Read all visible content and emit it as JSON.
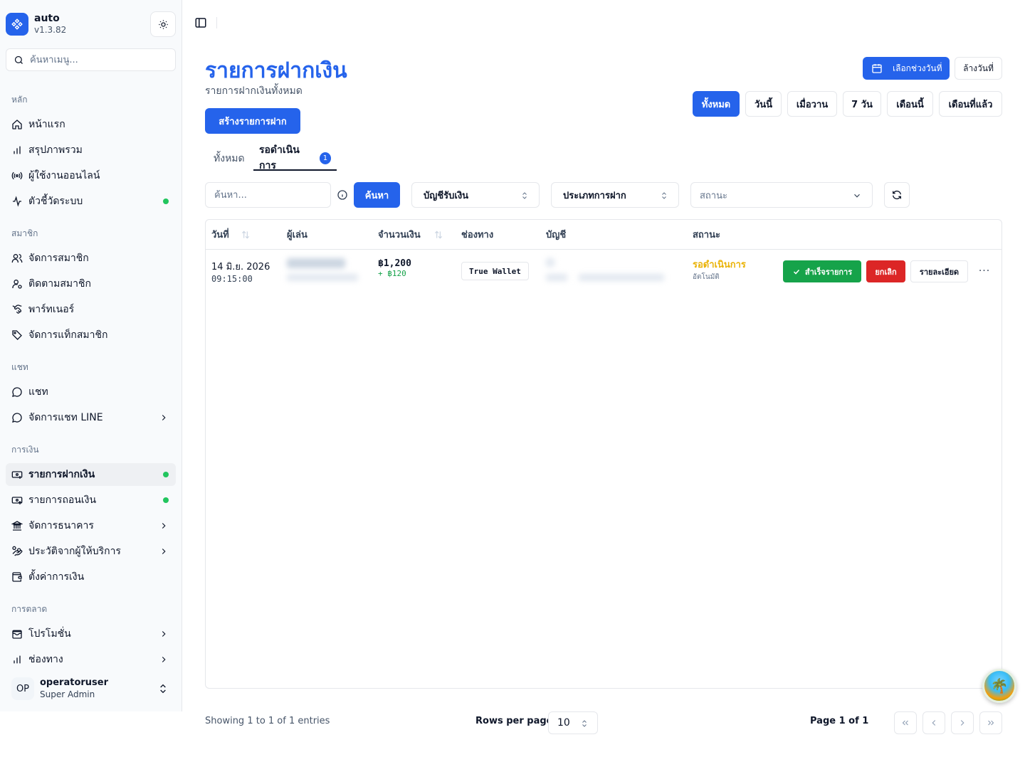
{
  "sidebar": {
    "brand": {
      "name": "auto",
      "version": "v1.3.82"
    },
    "search_placeholder": "ค้นหาเมนู...",
    "groups": {
      "main": "หลัก",
      "members": "สมาชิก",
      "chat": "แชท",
      "finance": "การเงิน",
      "marketing": "การตลาด"
    },
    "items": {
      "home": "หน้าแรก",
      "overview": "สรุปภาพรวม",
      "online_users": "ผู้ใช้งานออนไลน์",
      "metrics": "ตัวชี้วัดระบบ",
      "manage_members": "จัดการสมาชิก",
      "follow_members": "ติดตามสมาชิก",
      "partners": "พาร์ทเนอร์",
      "member_tags": "จัดการแท็กสมาชิก",
      "chat": "แชท",
      "line_chat": "จัดการแชท LINE",
      "deposits": "รายการฝากเงิน",
      "withdrawals": "รายการถอนเงิน",
      "banks": "จัดการธนาคาร",
      "provider_history": "ประวัติจากผู้ให้บริการ",
      "finance_settings": "ตั้งค่าการเงิน",
      "promotions": "โปรโมชั่น",
      "channels": "ช่องทาง"
    },
    "user": {
      "initials": "OP",
      "name": "operatoruser",
      "role": "Super Admin"
    }
  },
  "header": {
    "title": "รายการฝากเงิน",
    "subtitle": "รายการฝากเงินทั้งหมด",
    "create_button": "สร้างรายการฝาก",
    "date_picker_button": "เลือกช่วงวันที่",
    "clear_date_button": "ล้างวันที่",
    "ranges": [
      "ทั้งหมด",
      "วันนี้",
      "เมื่อวาน",
      "7 วัน",
      "เดือนนี้",
      "เดือนที่แล้ว"
    ],
    "active_range": "ทั้งหมด"
  },
  "tabs": {
    "all": "ทั้งหมด",
    "pending": "รอดำเนินการ",
    "pending_count": "1"
  },
  "filters": {
    "search_placeholder": "ค้นหา...",
    "search_button": "ค้นหา",
    "account_select": "บัญชีรับเงิน",
    "type_select": "ประเภทการฝาก",
    "status_placeholder": "สถานะ"
  },
  "table": {
    "headers": {
      "date": "วันที่",
      "player": "ผู้เล่น",
      "amount": "จำนวนเงิน",
      "channel": "ช่องทาง",
      "account": "บัญชี",
      "status": "สถานะ"
    },
    "rows": [
      {
        "date": "14 มิ.ย. 2026",
        "time": "09:15:00",
        "amount": "฿1,200",
        "bonus": "+ ฿120",
        "channel": "True Wallet",
        "status": "รอดำเนินการ",
        "status_sub": "อัตโนมัติ",
        "actions": {
          "approve": "สำเร็จรายการ",
          "cancel": "ยกเลิก",
          "detail": "รายละเอียด",
          "more": "···"
        }
      }
    ]
  },
  "footer": {
    "showing": "Showing 1 to 1 of 1 entries",
    "rows_per_page_label": "Rows per page",
    "rows_per_page": "10",
    "page_info": "Page 1 of 1"
  },
  "colors": {
    "primary": "#2563eb",
    "success": "#16a34a",
    "danger": "#dc2626",
    "pending": "#eab308",
    "online_dot": "#22c55e"
  }
}
